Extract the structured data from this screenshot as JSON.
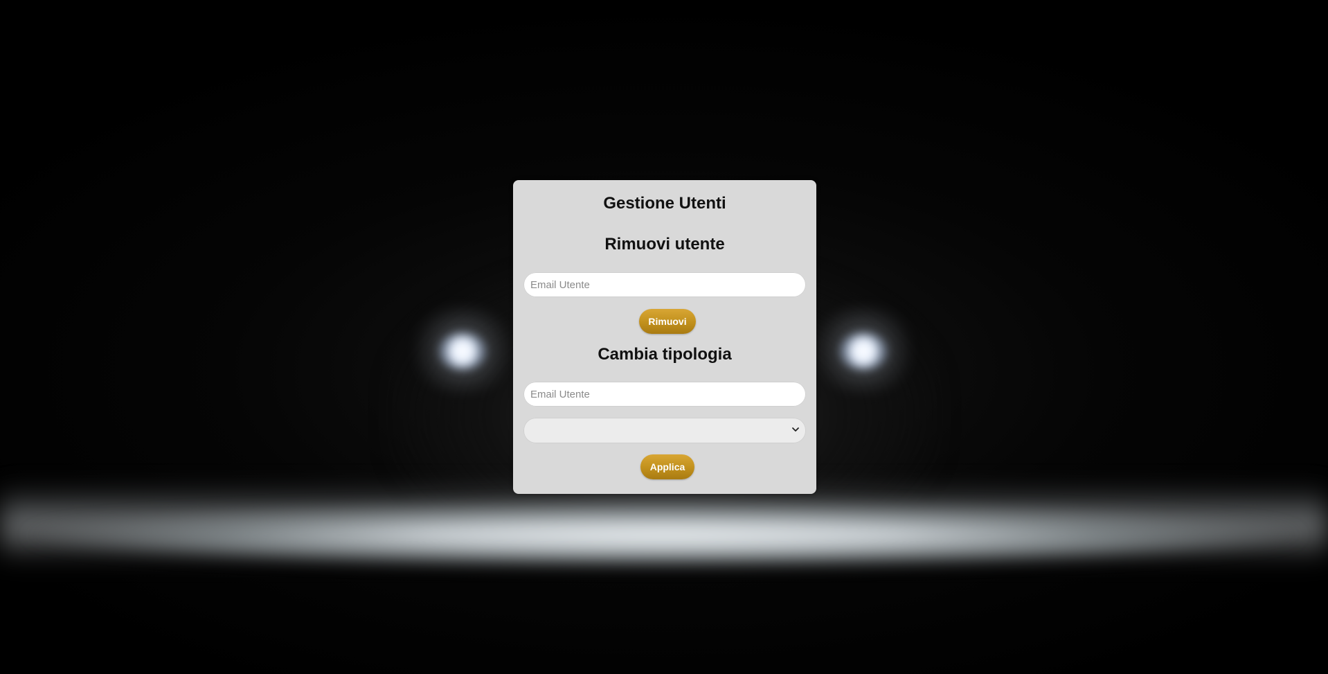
{
  "panel": {
    "title": "Gestione Utenti"
  },
  "remove_section": {
    "heading": "Rimuovi utente",
    "email_placeholder": "Email Utente",
    "email_value": "",
    "button_label": "Rimuovi"
  },
  "change_type_section": {
    "heading": "Cambia tipologia",
    "email_placeholder": "Email Utente",
    "email_value": "",
    "type_selected": "",
    "button_label": "Applica"
  },
  "colors": {
    "panel_background": "#d9d9d9",
    "button_gold": "#c1901c",
    "button_text": "#ffffff",
    "page_background": "#000000"
  },
  "icons": {
    "select_arrow": "chevron-down-icon"
  }
}
